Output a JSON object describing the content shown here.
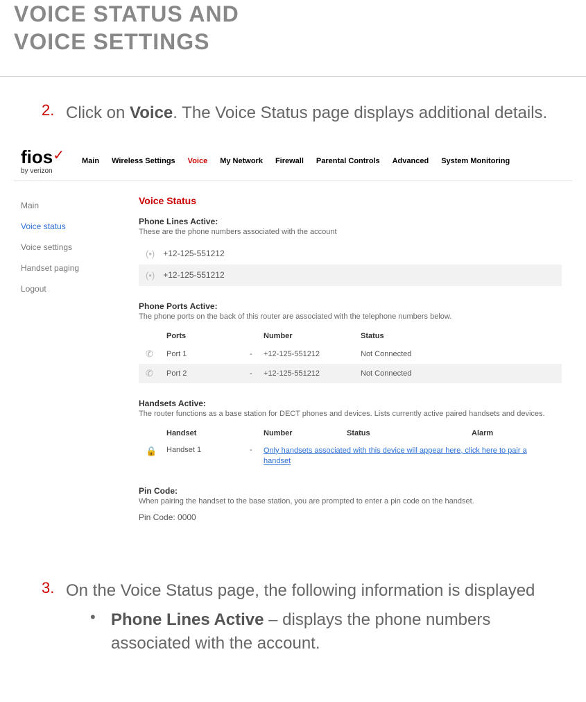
{
  "title_line1": "VOICE STATUS AND",
  "title_line2": "VOICE SETTINGS",
  "step2": {
    "num": "2.",
    "prefix": "Click on ",
    "bold": "Voice",
    "suffix": ". The Voice Status page displays additional details."
  },
  "screenshot": {
    "logo": {
      "fios": "fios",
      "by": "by verizon"
    },
    "topnav": [
      {
        "label": "Main",
        "active": false
      },
      {
        "label": "Wireless Settings",
        "active": false
      },
      {
        "label": "Voice",
        "active": true
      },
      {
        "label": "My Network",
        "active": false
      },
      {
        "label": "Firewall",
        "active": false
      },
      {
        "label": "Parental Controls",
        "active": false
      },
      {
        "label": "Advanced",
        "active": false
      },
      {
        "label": "System Monitoring",
        "active": false
      }
    ],
    "sidebar": [
      {
        "label": "Main",
        "active": false
      },
      {
        "label": "Voice status",
        "active": true
      },
      {
        "label": "Voice settings",
        "active": false
      },
      {
        "label": "Handset paging",
        "active": false
      },
      {
        "label": "Logout",
        "active": false
      }
    ],
    "section_title": "Voice Status",
    "phone_lines": {
      "label": "Phone Lines Active:",
      "desc": "These are the phone numbers associated with the account",
      "rows": [
        {
          "number": "+12-125-551212"
        },
        {
          "number": "+12-125-551212"
        }
      ]
    },
    "phone_ports": {
      "label": "Phone Ports Active:",
      "desc": "The phone ports on the back of this router are associated with the telephone numbers below.",
      "headers": {
        "c1": "Ports",
        "c2": "Number",
        "c3": "Status"
      },
      "rows": [
        {
          "port": "Port 1",
          "number": "+12-125-551212",
          "status": "Not Connected"
        },
        {
          "port": "Port 2",
          "number": "+12-125-551212",
          "status": "Not Connected"
        }
      ]
    },
    "handsets": {
      "label": "Handsets Active:",
      "desc": "The router functions as a base station for DECT phones and devices. Lists currently active paired handsets and devices.",
      "headers": {
        "c1": "Handset",
        "c2": "Number",
        "c3": "Status",
        "c4": "Alarm"
      },
      "rows": [
        {
          "handset": "Handset 1",
          "link": "Only handsets associated with this device will appear here, click here to pair a handset"
        }
      ]
    },
    "pin": {
      "label": "Pin Code:",
      "desc": "When pairing the handset to the base station, you are prompted to enter a pin code on the handset.",
      "value": "Pin Code: 0000"
    }
  },
  "step3": {
    "num": "3.",
    "text": "On the Voice Status page, the following information is displayed",
    "bullet": {
      "bold": "Phone Lines Active",
      "rest": " – displays the phone numbers associated with the account."
    }
  }
}
